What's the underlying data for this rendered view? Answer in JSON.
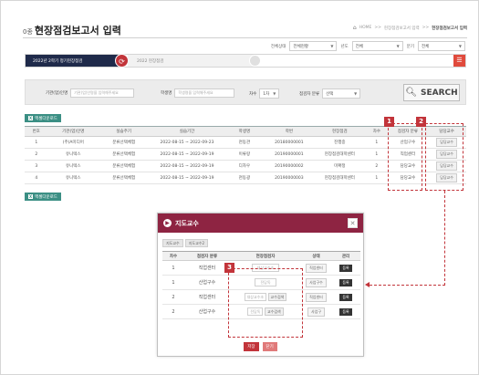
{
  "header": {
    "prefix": "0종",
    "title": "현장점검보고서 입력",
    "breadcrumb": [
      "HOME",
      "현장점검보고서 입력",
      "현장점검보고서 입력"
    ]
  },
  "top_filter": {
    "label1": "전체상태",
    "select1": "전체현황",
    "label2": "년도",
    "select2": "전체",
    "label3": "분기",
    "select3": "전체"
  },
  "period": {
    "active": "2022년 2학기 정기현장점검",
    "next": "2022 현장점검"
  },
  "search": {
    "field1_label": "기관(업)인명",
    "field1_placeholder": "기관(업)인명을 입력해주세요",
    "field2_label": "학생명",
    "field2_placeholder": "학생명을 입력해주세요",
    "field3_label": "차수",
    "field3_value": "1차",
    "field4_label": "점검자 분류",
    "field4_value": "선택",
    "button": "SEARCH"
  },
  "excel_button": "엑셀다운로드",
  "table": {
    "headers": [
      "번호",
      "기관(업)인명",
      "실습주기",
      "실습기간",
      "학생명",
      "학번",
      "현장점검",
      "차수",
      "점검자 분류",
      "담당교수"
    ],
    "rows": [
      [
        "1",
        "(주)A미디어",
        "분류선택체험",
        "2022-08-15 ~ 2022-09-23",
        "천동관",
        "20180000001",
        "진행중",
        "1",
        "산업구수",
        "담당교수"
      ],
      [
        "2",
        "유니텍스",
        "분류선택체험",
        "2022-08-15 ~ 2022-09-19",
        "이류랑",
        "20190000001",
        "현장점검대학센터",
        "1",
        "직업센터",
        "담당교수"
      ],
      [
        "3",
        "유니텍스",
        "분류선택체험",
        "2022-08-15 ~ 2022-09-19",
        "디자우",
        "20190000002",
        "미확정",
        "2",
        "담당교수",
        "담당교수"
      ],
      [
        "4",
        "유니텍스",
        "분류선택체험",
        "2022-08-15 ~ 2022-09-19",
        "천동광",
        "20190000003",
        "현장점검대학센터",
        "1",
        "담당교수",
        "담당교수"
      ]
    ]
  },
  "markers": [
    "1",
    "2",
    "3"
  ],
  "modal": {
    "title": "지도교수",
    "close": "✕",
    "tabs": [
      "지도교수",
      "지도교수2"
    ],
    "headers": [
      "차수",
      "점검자 분류",
      "현장점검자",
      "상태",
      "관리"
    ],
    "rows": [
      {
        "round": "1",
        "type": "직업센터",
        "inspector": "대상교수조",
        "extra": "",
        "status": "직업센터",
        "action": "등록"
      },
      {
        "round": "1",
        "type": "산업구수",
        "inspector": "전담독",
        "extra": "",
        "status": "사업구수",
        "action": "등록"
      },
      {
        "round": "2",
        "type": "직업센터",
        "inspector": "대상교수조",
        "extra": "교수검색",
        "status": "직업센터",
        "action": "등록"
      },
      {
        "round": "2",
        "type": "산업구수",
        "inspector": "전담독",
        "extra": "교수검색",
        "status": "사업구",
        "action": "등록"
      }
    ],
    "save": "저장",
    "cancel": "닫기"
  },
  "colors": {
    "accent": "#c2343a",
    "modal_header": "#8e2442",
    "period_dark": "#1f2a4a",
    "excel": "#3b8f84"
  }
}
